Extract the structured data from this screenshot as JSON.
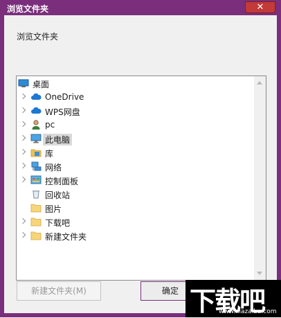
{
  "window": {
    "title": "浏览文件夹",
    "close_glyph": "✕"
  },
  "description": "浏览文件夹",
  "tree": {
    "items": [
      {
        "label": "桌面",
        "icon": "desktop-icon",
        "level": 0,
        "expandable": false,
        "selected": false
      },
      {
        "label": "OneDrive",
        "icon": "cloud-icon",
        "level": 1,
        "expandable": true,
        "selected": false
      },
      {
        "label": "WPS网盘",
        "icon": "cloud-icon",
        "level": 1,
        "expandable": true,
        "selected": false
      },
      {
        "label": "pc",
        "icon": "user-icon",
        "level": 1,
        "expandable": true,
        "selected": false
      },
      {
        "label": "此电脑",
        "icon": "computer-icon",
        "level": 1,
        "expandable": true,
        "selected": true
      },
      {
        "label": "库",
        "icon": "library-icon",
        "level": 1,
        "expandable": true,
        "selected": false
      },
      {
        "label": "网络",
        "icon": "network-icon",
        "level": 1,
        "expandable": true,
        "selected": false
      },
      {
        "label": "控制面板",
        "icon": "control-panel-icon",
        "level": 1,
        "expandable": true,
        "selected": false
      },
      {
        "label": "回收站",
        "icon": "recycle-bin-icon",
        "level": 1,
        "expandable": false,
        "selected": false
      },
      {
        "label": "图片",
        "icon": "folder-icon",
        "level": 1,
        "expandable": false,
        "selected": false
      },
      {
        "label": "下载吧",
        "icon": "folder-icon",
        "level": 1,
        "expandable": true,
        "selected": false
      },
      {
        "label": "新建文件夹",
        "icon": "folder-icon",
        "level": 1,
        "expandable": true,
        "selected": false
      }
    ]
  },
  "buttons": {
    "new_folder": "新建文件夹(M)",
    "ok": "确定"
  },
  "watermark": {
    "main": "下载吧",
    "sub": "www.xiazaiba.com"
  },
  "colors": {
    "title_bar": "#7a2e7c",
    "close_button": "#c23a3a",
    "selection": "#d9d9d9"
  }
}
